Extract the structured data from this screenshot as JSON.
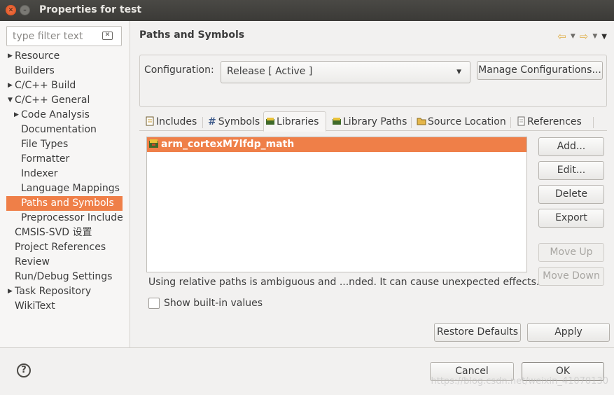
{
  "window": {
    "title": "Properties for test"
  },
  "sidebar": {
    "filter_placeholder": "type filter text",
    "items": [
      {
        "label": "Resource",
        "level": 0,
        "arrow": true
      },
      {
        "label": "Builders",
        "level": 0,
        "arrow": false
      },
      {
        "label": "C/C++ Build",
        "level": 0,
        "arrow": true
      },
      {
        "label": "C/C++ General",
        "level": 0,
        "arrow": true,
        "expanded": true
      },
      {
        "label": "Code Analysis",
        "level": 1,
        "arrow": true
      },
      {
        "label": "Documentation",
        "level": 1,
        "arrow": false
      },
      {
        "label": "File Types",
        "level": 1,
        "arrow": false
      },
      {
        "label": "Formatter",
        "level": 1,
        "arrow": false
      },
      {
        "label": "Indexer",
        "level": 1,
        "arrow": false
      },
      {
        "label": "Language Mappings",
        "level": 1,
        "arrow": false
      },
      {
        "label": "Paths and Symbols",
        "level": 1,
        "arrow": false,
        "selected": true
      },
      {
        "label": "Preprocessor Include",
        "level": 1,
        "arrow": false
      },
      {
        "label": "CMSIS-SVD 设置",
        "level": 0,
        "arrow": false
      },
      {
        "label": "Project References",
        "level": 0,
        "arrow": false
      },
      {
        "label": "Review",
        "level": 0,
        "arrow": false
      },
      {
        "label": "Run/Debug Settings",
        "level": 0,
        "arrow": false
      },
      {
        "label": "Task Repository",
        "level": 0,
        "arrow": true
      },
      {
        "label": "WikiText",
        "level": 0,
        "arrow": false
      }
    ]
  },
  "page": {
    "title": "Paths and Symbols",
    "configuration_label": "Configuration:",
    "configuration_value": "Release  [ Active ]",
    "manage_configurations": "Manage Configurations..."
  },
  "tabs": [
    {
      "label": "Includes",
      "icon": "includes-icon"
    },
    {
      "label": "Symbols",
      "icon": "hash-icon"
    },
    {
      "label": "Libraries",
      "icon": "library-icon",
      "active": true
    },
    {
      "label": "Library Paths",
      "icon": "library-paths-icon"
    },
    {
      "label": "Source Location",
      "icon": "folder-icon"
    },
    {
      "label": "References",
      "icon": "references-icon"
    }
  ],
  "libraries": {
    "rows": [
      {
        "label": "arm_cortexM7lfdp_math",
        "selected": true
      }
    ],
    "buttons": {
      "add": "Add...",
      "edit": "Edit...",
      "delete": "Delete",
      "export": "Export",
      "move_up": "Move Up",
      "move_down": "Move Down"
    },
    "warning": "Using relative paths is ambiguous and ...nded. It can cause unexpected effects.",
    "show_builtin": "Show built-in values"
  },
  "actions": {
    "restore_defaults": "Restore Defaults",
    "apply": "Apply",
    "cancel": "Cancel",
    "ok": "OK"
  },
  "watermark": "https://blog.csdn.net/weixin_41070130",
  "colors": {
    "selection": "#ef7f48",
    "titlebar": "#3b3a37"
  }
}
